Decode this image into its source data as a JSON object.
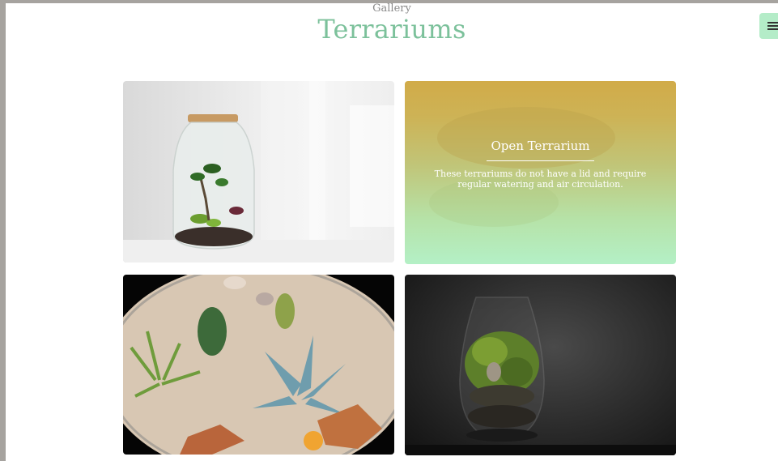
{
  "header": {
    "kicker": "Gallery",
    "title": "Terrariums"
  },
  "menu": {
    "icon": "hamburger-menu-icon"
  },
  "gallery": {
    "cards": [
      {
        "name": "card-jar-terrarium",
        "image": "closed jar terrarium with cork lid"
      },
      {
        "name": "card-open-terrarium",
        "title": "Open Terrarium",
        "description": "These terrariums do not have a lid and require regular watering and air circulation."
      },
      {
        "name": "card-succulent-terrarium",
        "image": "succulents and cacti in a glass bowl"
      },
      {
        "name": "card-moss-terrarium",
        "image": "moss terrarium in a glass vase"
      }
    ]
  },
  "colors": {
    "title": "#7cc19b",
    "menu_button": "#b4ecc8",
    "overlay_top": "#d1ab49",
    "overlay_bottom": "#b4f0c6"
  }
}
